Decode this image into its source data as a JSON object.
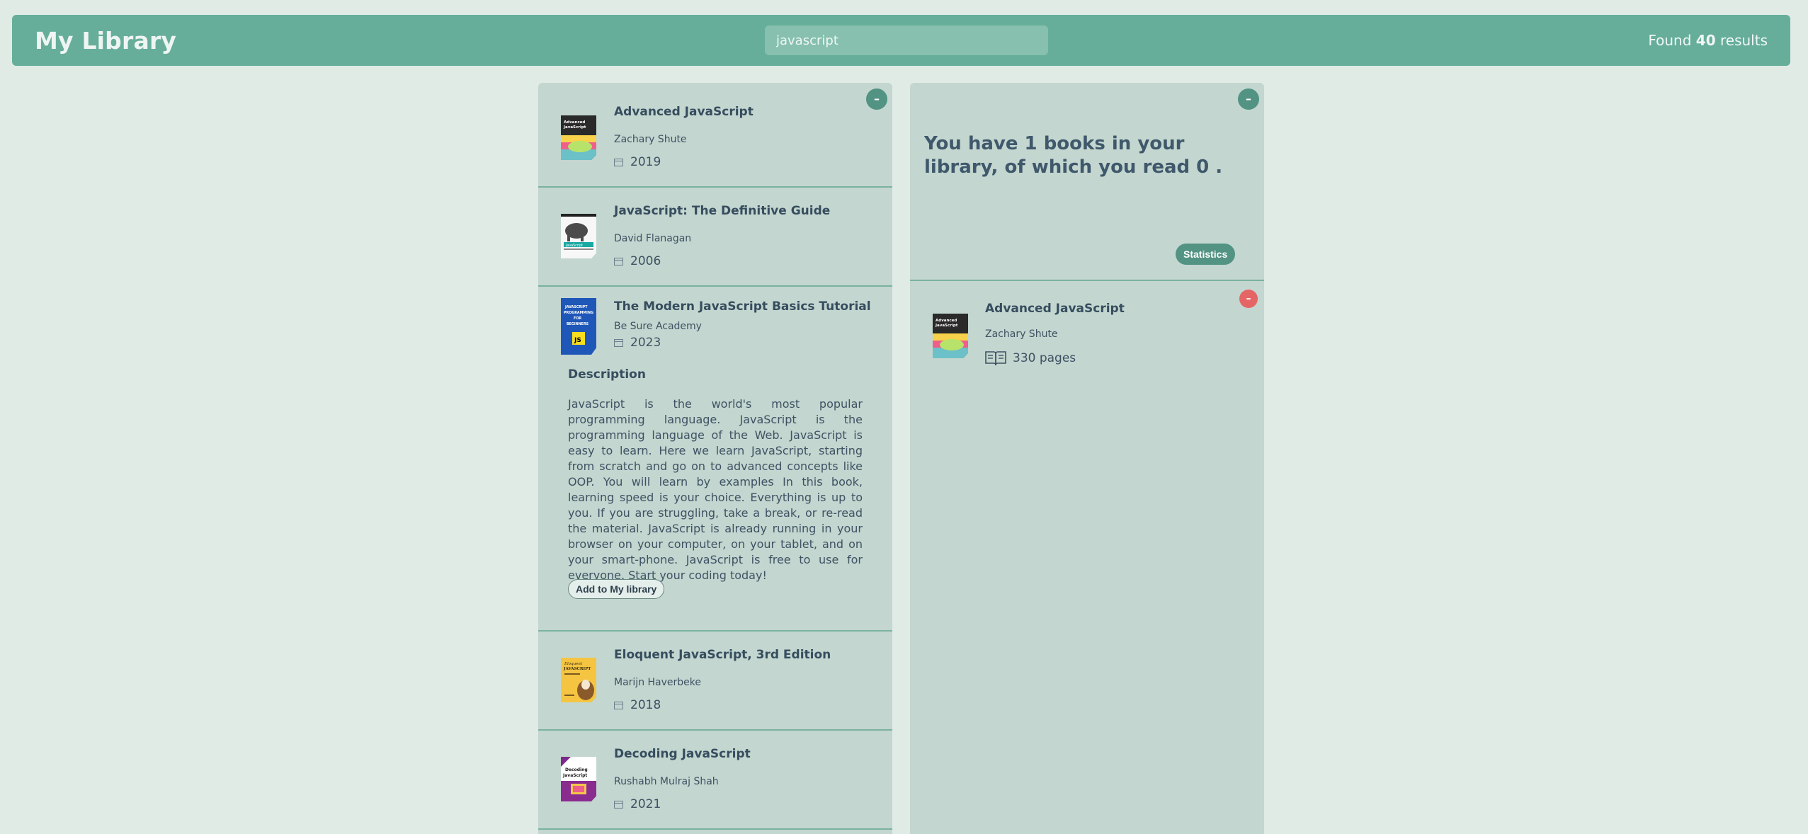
{
  "header": {
    "title": "My Library",
    "search_value": "javascript",
    "results_prefix": "Found",
    "results_count": "40",
    "results_suffix": "results"
  },
  "search_results": {
    "collapse_label": "–",
    "books": [
      {
        "title": "Advanced JavaScript",
        "author": "Zachary Shute",
        "year": "2019"
      },
      {
        "title": "JavaScript: The Definitive Guide",
        "author": "David Flanagan",
        "year": "2006"
      },
      {
        "title": "The Modern JavaScript Basics Tutorial",
        "author": "Be Sure Academy",
        "year": "2023"
      },
      {
        "title": "Eloquent JavaScript, 3rd Edition",
        "author": "Marijn Haverbeke",
        "year": "2018"
      },
      {
        "title": "Decoding JavaScript",
        "author": "Rushabh Mulraj Shah",
        "year": "2021"
      }
    ],
    "expanded": {
      "description_heading": "Description",
      "description": "JavaScript is the world's most popular programming language. JavaScript is the programming language of the Web. JavaScript is easy to learn. Here we learn JavaScript, starting from scratch and go on to advanced concepts like OOP. You will learn by examples In this book, learning speed is your choice. Everything is up to you. If you are struggling, take a break, or re-read the material. JavaScript is already running in your browser on your computer, on your tablet, and on your smart-phone. JavaScript is free to use for everyone. Start your coding today!",
      "add_button": "Add to My library"
    }
  },
  "my_library": {
    "collapse_label": "–",
    "summary": "You have 1 books in your library, of which you read 0 .",
    "statistics_button": "Statistics",
    "remove_label": "–",
    "books": [
      {
        "title": "Advanced JavaScript",
        "author": "Zachary Shute",
        "pages": "330 pages"
      }
    ]
  },
  "colors": {
    "header": "#66ae9a",
    "panel": "#c3d6cf",
    "accent": "#529383",
    "remove": "#e56565",
    "background": "#e0ebe6"
  }
}
